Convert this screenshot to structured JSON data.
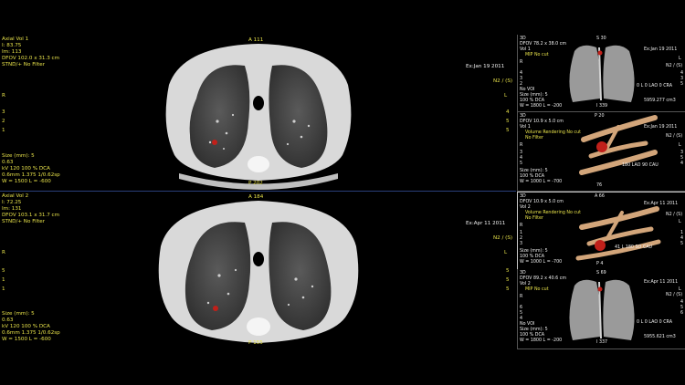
{
  "viewports": {
    "axial1": {
      "title": "Axial Vol 1",
      "lines": [
        "I: 83.75",
        "Im: 113",
        "DFOV 102.0 x 31.3 cm",
        "STND/+ No Filter"
      ],
      "anterior": "A 111",
      "posterior": "P 202",
      "date": "Ex:Jan 19 2011",
      "n2": "N2 / (S)",
      "r": "R",
      "l": "L",
      "left_ticks": [
        "3",
        "2",
        "1"
      ],
      "right_ticks": [
        "4",
        "5",
        "5"
      ],
      "bottom": [
        "Size (mm): 5",
        "0.63",
        "kV 120 100 % DCA",
        "0.6mm 1.375 1/0.62sp",
        "W = 1500 L = -600"
      ]
    },
    "axial2": {
      "title": "Axial Vol 2",
      "lines": [
        "I: 72.25",
        "Im: 131",
        "DFOV 103.1 x 31.7 cm",
        "STND/+ No Filter"
      ],
      "anterior": "A 184",
      "posterior": "P 155",
      "date": "Ex:Apr 11 2011",
      "n2": "N2 / (S)",
      "r": "R",
      "l": "L",
      "left_ticks": [
        "5",
        "1",
        "1"
      ],
      "right_ticks": [
        "5",
        "5",
        "5"
      ],
      "bottom": [
        "Size (mm): 5",
        "0.63",
        "kV 120 100 % DCA",
        "0.6mm 1.375 1/0.62sp",
        "W = 1500 L = -600"
      ]
    },
    "side1": {
      "header": [
        "3D",
        "DFOV 78.2 x 38.0 cm",
        "Vol 1",
        "MIP No cut"
      ],
      "s": "S 30",
      "r": "R",
      "l": "L",
      "date": "Ex:Jan 19 2011",
      "n2": "N2 / (S)",
      "ticks_left": [
        "4",
        "3",
        "2"
      ],
      "ticks_right": [
        "4",
        "3",
        "5"
      ],
      "novoi": "No VOI",
      "angle": "0 L 0 LAO 0 CRA",
      "bottom": [
        "Size (mm): 5",
        "100 % DCA",
        "W = 1800 L = -200"
      ],
      "i_label": "I 339",
      "volume": "5959.277 cm3"
    },
    "side2": {
      "header": [
        "3D",
        "DFOV 10.9 x 5.0 cm",
        "Vol 1",
        "Volume Rendering No cut",
        "No Filter"
      ],
      "p": "P 20",
      "date": "Ex:Jan 19 2011",
      "n2": "N2 / (S)",
      "r": "R",
      "l": "L",
      "ticks_left": [
        "3",
        "4",
        "5"
      ],
      "ticks_right": [
        "3",
        "5",
        "4"
      ],
      "angle": "180 LAO 90 CAU",
      "bottom": [
        "Size (mm): 5",
        "100 % DCA",
        "W = 1000 L = -700"
      ],
      "i_label": "76"
    },
    "side3": {
      "header": [
        "3D",
        "DFOV 10.9 x 5.0 cm",
        "Vol 2",
        "Volume Rendering No cut",
        "No Filter"
      ],
      "a": "A 66",
      "date": "Ex:Apr 11 2011",
      "n2": "N2 / (S)",
      "r": "R",
      "l": "L",
      "ticks_left": [
        "1",
        "2",
        "3"
      ],
      "ticks_right": [
        "1",
        "4",
        "5"
      ],
      "angle": "41 L 180 SO CAU",
      "bottom": [
        "Size (mm): 5",
        "100 % DCA",
        "W = 1000 L = -700"
      ],
      "i_label": "P 4"
    },
    "side4": {
      "header": [
        "3D",
        "DFOV 89.2 x 40.6 cm",
        "Vol 2",
        "MIP No cut"
      ],
      "s": "S 69",
      "date": "Ex:Apr 11 2011",
      "n2": "N2 / (S)",
      "r": "R",
      "l": "L",
      "ticks_left": [
        "6",
        "5",
        "4"
      ],
      "ticks_right": [
        "4",
        "5",
        "6"
      ],
      "novoi": "No VOI",
      "angle": "0 L 0 LAO 0 CRA",
      "bottom": [
        "Size (mm): 5",
        "100 % DCA",
        "W = 1800 L = -200"
      ],
      "i_label": "I 337",
      "volume": "5955.621 cm3"
    }
  }
}
